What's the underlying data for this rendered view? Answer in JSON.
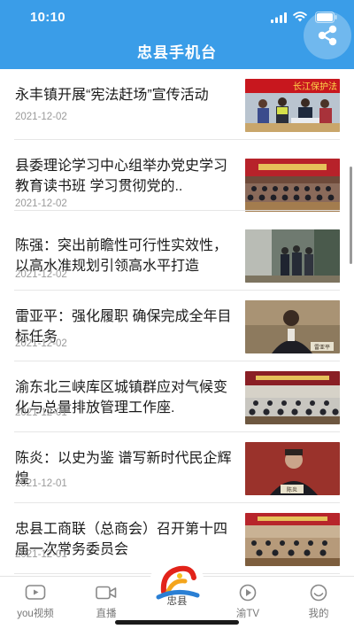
{
  "status_bar": {
    "time": "10:10"
  },
  "header": {
    "title": "忠县手机台"
  },
  "articles": [
    {
      "title": "永丰镇开展“宪法赶场”宣传活动",
      "date": "2021-12-02",
      "photo_caption": "长江保护法"
    },
    {
      "title": "县委理论学习中心组举办党史学习教育读书班 学习贯彻党的..",
      "date": "2021-12-02"
    },
    {
      "title": "陈强：突出前瞻性可行性实效性，以高水准规划引领高水平打造",
      "date": "2021-12-02"
    },
    {
      "title": "雷亚平：强化履职 确保完成全年目标任务",
      "date": "2021-12-02",
      "photo_caption": "雷亚平"
    },
    {
      "title": "渝东北三峡库区城镇群应对气候变化与总量排放管理工作座.",
      "date": "2021-12-01"
    },
    {
      "title": "陈炎：以史为鉴 谱写新时代民企辉煌",
      "date": "2021-12-01",
      "photo_caption": "陈炎"
    },
    {
      "title": "忠县工商联（总商会）召开第十四届一次常务委员会",
      "date": "2021-12-01"
    }
  ],
  "tabbar": {
    "tabs": [
      {
        "label": "you视频",
        "icon": "video-icon"
      },
      {
        "label": "直播",
        "icon": "camera-icon"
      },
      {
        "label": "忠县",
        "icon": "logo-icon"
      },
      {
        "label": "渝TV",
        "icon": "tv-play-icon"
      },
      {
        "label": "我的",
        "icon": "smile-icon"
      }
    ]
  },
  "colors": {
    "primary": "#3a9de8",
    "text": "#1a1a1a",
    "muted": "#9a9a9a"
  }
}
